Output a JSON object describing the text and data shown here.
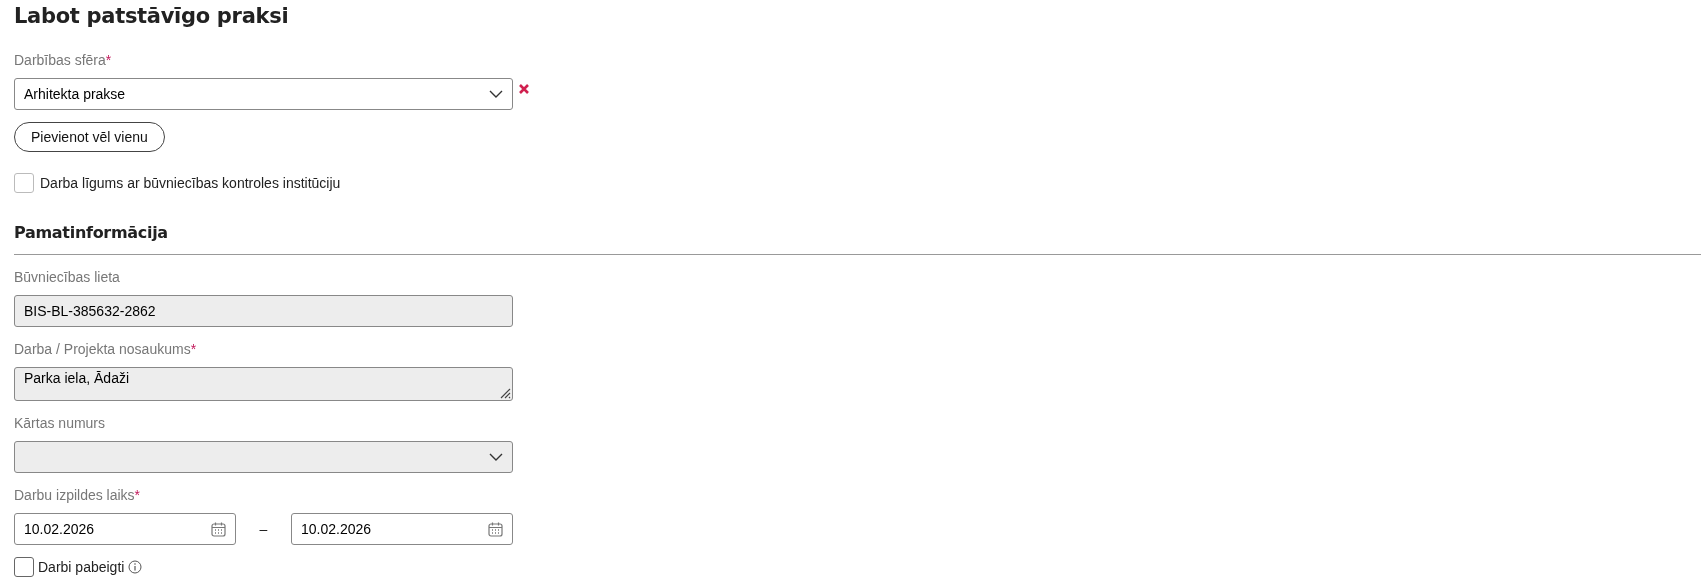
{
  "title": "Labot patstāvīgo praksi",
  "activity": {
    "label": "Darbības sfēra",
    "required_mark": "*",
    "value": "Arhitekta prakse",
    "add_button": "Pievienot vēl vienu"
  },
  "contract_checkbox": {
    "label": "Darba līgums ar būvniecības kontroles institūciju",
    "checked": false
  },
  "section": {
    "title": "Pamatinformācija"
  },
  "fields": [
    {
      "kind": "input",
      "label": "Būvniecības lieta",
      "value": "BIS-BL-385632-2862",
      "disabled": true
    },
    {
      "kind": "textarea",
      "label": "Darba / Projekta nosaukums",
      "required_mark": "*",
      "value": "Parka iela, Ādaži",
      "disabled": true
    },
    {
      "kind": "select",
      "label": "Kārtas numurs",
      "disabled": true
    },
    {
      "kind": "daterange",
      "label": "Darbu izpildes laiks",
      "required_mark": "*",
      "from": "10.02.2026",
      "separator": "–",
      "to": "10.02.2026",
      "disabled": false
    }
  ],
  "done_checkbox": {
    "label": "Darbi pabeigti",
    "checked": false
  }
}
